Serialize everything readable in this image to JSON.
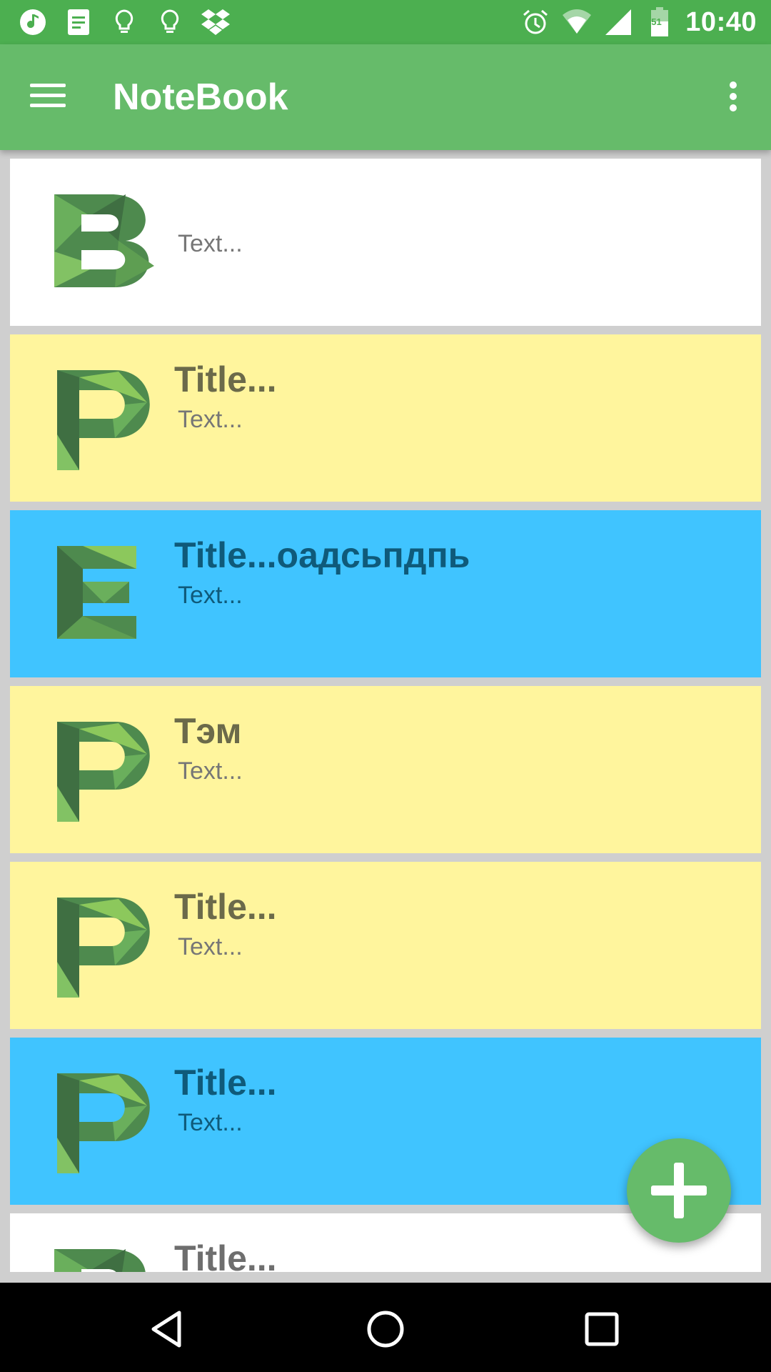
{
  "status_bar": {
    "time": "10:40",
    "left_icons": [
      "music-icon",
      "note-icon",
      "bulb-icon",
      "bulb-icon",
      "dropbox-icon"
    ],
    "right_icons": [
      "alarm-icon",
      "wifi-icon",
      "signal-icon",
      "battery-icon"
    ],
    "battery_level": "51"
  },
  "toolbar": {
    "title": "NoteBook",
    "menu_icon": "menu-icon",
    "overflow_icon": "more-vert-icon"
  },
  "notes": [
    {
      "letter": "B",
      "title": "",
      "text": "Text...",
      "color": "white"
    },
    {
      "letter": "P",
      "title": "Title...",
      "text": "Text...",
      "color": "yellow"
    },
    {
      "letter": "E",
      "title": "Title...оадсьпдпь",
      "text": "Text...",
      "color": "blue"
    },
    {
      "letter": "P",
      "title": "Тэм",
      "text": "Text...",
      "color": "yellow"
    },
    {
      "letter": "P",
      "title": "Title...",
      "text": "Text...",
      "color": "yellow"
    },
    {
      "letter": "P",
      "title": "Title...",
      "text": "Text...",
      "color": "blue"
    },
    {
      "letter": "B",
      "title": "Title...",
      "text": "",
      "color": "white"
    }
  ],
  "fab": {
    "icon": "add-icon"
  },
  "nav": {
    "back": "back-icon",
    "home": "home-icon",
    "recents": "recents-icon"
  },
  "colors": {
    "primary": "#66bb6a",
    "primary_dark": "#4caf50",
    "yellow": "#fff59d",
    "blue": "#40c4ff"
  }
}
